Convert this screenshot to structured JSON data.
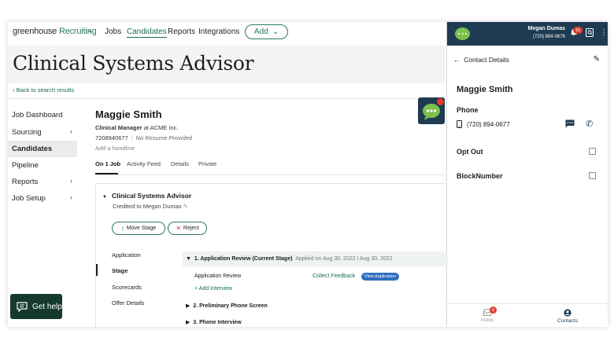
{
  "nav": {
    "brand_a": "greenhouse",
    "brand_b": "Recruiting",
    "links": [
      "Jobs",
      "Candidates",
      "Reports",
      "Integrations"
    ],
    "add_label": "Add"
  },
  "job": {
    "title": "Clinical Systems Advisor",
    "back_link": "Back to search results"
  },
  "sidebar": {
    "items": [
      "Job Dashboard",
      "Sourcing",
      "Candidates",
      "Pipeline",
      "Reports",
      "Job Setup"
    ]
  },
  "candidate": {
    "name": "Maggie Smith",
    "role": "Clinical Manager",
    "company": "at ACME Inc.",
    "phone": "7208940677",
    "resume": "No Resume Provided",
    "headline_placeholder": "Add a headline",
    "tabs": [
      "On 1 Job",
      "Activity Feed",
      "Details",
      "Private"
    ]
  },
  "application": {
    "title": "Clinical Systems Advisor",
    "credited": "Credited to Megan Dumas",
    "move_stage": "Move Stage",
    "reject": "Reject",
    "subnav": [
      "Application",
      "Stage",
      "Scorecards",
      "Offer Details"
    ],
    "stages": [
      {
        "label": "1.  Application Review (Current Stage)",
        "meta": "Applied on Aug 30, 2022 | Aug 30, 2022"
      },
      {
        "label": "2.  Preliminary Phone Screen",
        "meta": ""
      },
      {
        "label": "3.  Phone Interview",
        "meta": ""
      }
    ],
    "review_row": "Application Review",
    "collect_feedback": "Collect Feedback",
    "view_application": "View Application",
    "add_interview": "+ Add Interview"
  },
  "help": {
    "label": "Get help"
  },
  "panel": {
    "user_name": "Megan Dumas",
    "user_phone": "(720) 894-0676",
    "notif_count": "15",
    "header": "Contact Details",
    "contact_name": "Maggie Smith",
    "phone_label": "Phone",
    "phone_value": "(720) 894-0677",
    "opt_out": "Opt Out",
    "block_number": "BlockNumber",
    "footer_inbox": "Inbox",
    "footer_inbox_count": "8",
    "footer_contacts": "Contacts"
  },
  "colors": {
    "brand_green": "#1a6b55",
    "panel_navy": "#1f3b52",
    "badge_red": "#e23a2e",
    "view_blue": "#2f6fbd"
  }
}
